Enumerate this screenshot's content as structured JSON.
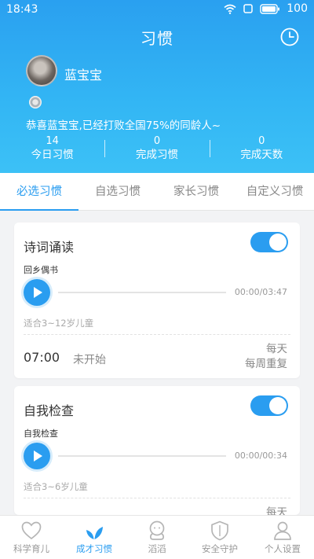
{
  "status_bar": {
    "time": "18:43",
    "battery": "100"
  },
  "header": {
    "title": "习惯",
    "user_name": "蓝宝宝",
    "congrats": "恭喜蓝宝宝,已经打败全国75%的同龄人~"
  },
  "stats": [
    {
      "value": "14",
      "label": "今日习惯"
    },
    {
      "value": "0",
      "label": "完成习惯"
    },
    {
      "value": "0",
      "label": "完成天数"
    }
  ],
  "tabs": [
    {
      "label": "必选习惯",
      "active": true
    },
    {
      "label": "自选习惯",
      "active": false
    },
    {
      "label": "家长习惯",
      "active": false
    },
    {
      "label": "自定义习惯",
      "active": false
    }
  ],
  "cards": [
    {
      "title": "诗词诵读",
      "enabled": true,
      "track": "回乡偶书",
      "time": "00:00/03:47",
      "progress": 0,
      "age": "适合3~12岁儿童",
      "reminder_time": "07:00",
      "status": "未开始",
      "repeat_line1": "每天",
      "repeat_line2": "每周重复"
    },
    {
      "title": "自我检查",
      "enabled": true,
      "track": "自我检查",
      "time": "00:00/00:34",
      "progress": 0,
      "age": "适合3~6岁儿童",
      "repeat_line1": "每天"
    }
  ],
  "bottom_nav": [
    {
      "label": "科学育儿",
      "icon": "heart-icon",
      "active": false
    },
    {
      "label": "成才习惯",
      "icon": "sprout-icon",
      "active": true
    },
    {
      "label": "滔滔",
      "icon": "mascot-icon",
      "active": false
    },
    {
      "label": "安全守护",
      "icon": "shield-icon",
      "active": false
    },
    {
      "label": "个人设置",
      "icon": "person-icon",
      "active": false
    }
  ],
  "colors": {
    "accent": "#2a9df0",
    "header_gradient_start": "#2aa0f0",
    "header_gradient_end": "#3cc1f6"
  }
}
